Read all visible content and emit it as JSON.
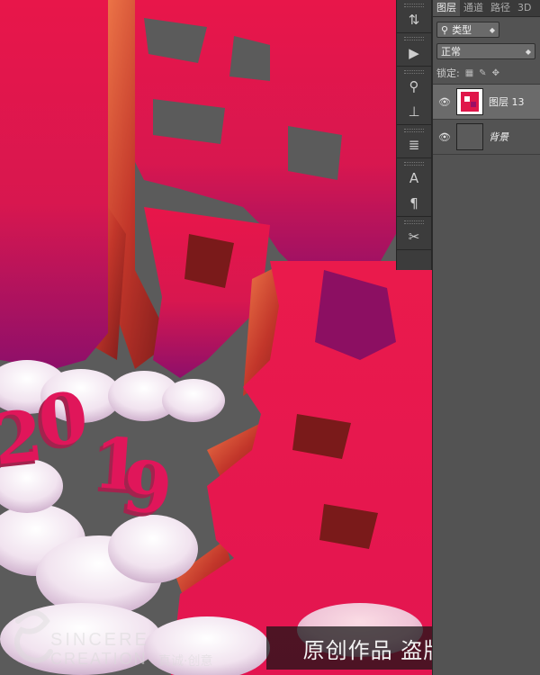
{
  "canvas": {
    "year_text": "2019",
    "colors": {
      "primary": "#e51747",
      "secondary": "#9a0f66",
      "extrude": "#e8643a",
      "background": "#5a5a5a",
      "cloud": "#f3e7f0"
    }
  },
  "watermark": {
    "text": "原创作品 盗版必究",
    "brand_name": "SINCERE",
    "brand_sub": "CREATION",
    "brand_cn": "真诚·创意"
  },
  "tool_strip": {
    "groups": [
      {
        "tools": [
          {
            "icon": "history-icon",
            "glyph": "⇅"
          }
        ]
      },
      {
        "tools": [
          {
            "icon": "actions-play-icon",
            "glyph": "▶"
          }
        ]
      },
      {
        "tools": [
          {
            "icon": "brush-presets-icon",
            "glyph": "⚲"
          },
          {
            "icon": "brush-settings-icon",
            "glyph": "⊥"
          }
        ]
      },
      {
        "tools": [
          {
            "icon": "clone-source-icon",
            "glyph": "≣"
          }
        ]
      },
      {
        "tools": [
          {
            "icon": "character-icon",
            "glyph": "A"
          },
          {
            "icon": "paragraph-icon",
            "glyph": "¶"
          }
        ]
      },
      {
        "tools": [
          {
            "icon": "tool-presets-icon",
            "glyph": "✂"
          }
        ]
      }
    ]
  },
  "layers_panel": {
    "tabs": [
      {
        "label": "图层",
        "active": true
      },
      {
        "label": "通道",
        "active": false
      },
      {
        "label": "路径",
        "active": false
      },
      {
        "label": "3D",
        "active": false
      }
    ],
    "filter": {
      "search_icon": "search-icon",
      "value": "类型"
    },
    "blend_mode": "正常",
    "lock_label": "锁定:",
    "layers": [
      {
        "name": "图层 13",
        "visible": true,
        "selected": true,
        "italic": false
      },
      {
        "name": "背景",
        "visible": true,
        "selected": false,
        "italic": true
      }
    ]
  }
}
